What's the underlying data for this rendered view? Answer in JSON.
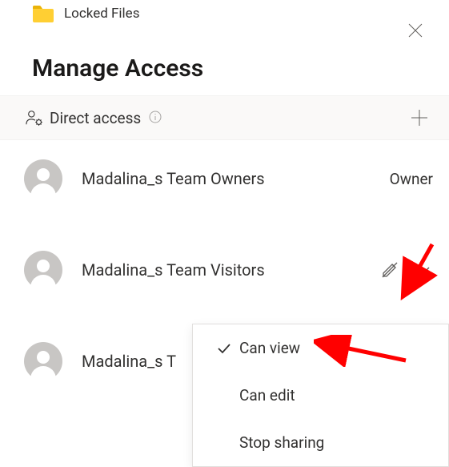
{
  "header": {
    "folder_name": "Locked Files"
  },
  "title": "Manage Access",
  "section": {
    "label": "Direct access"
  },
  "principals": [
    {
      "name": "Madalina_s Team Owners",
      "role": "Owner"
    },
    {
      "name": "Madalina_s Team Visitors",
      "role": null,
      "has_dropdown": true
    },
    {
      "name": "Madalina_s T",
      "role": null
    }
  ],
  "dropdown": {
    "items": [
      {
        "label": "Can view",
        "selected": true
      },
      {
        "label": "Can edit",
        "selected": false
      },
      {
        "label": "Stop sharing",
        "selected": false
      }
    ]
  }
}
